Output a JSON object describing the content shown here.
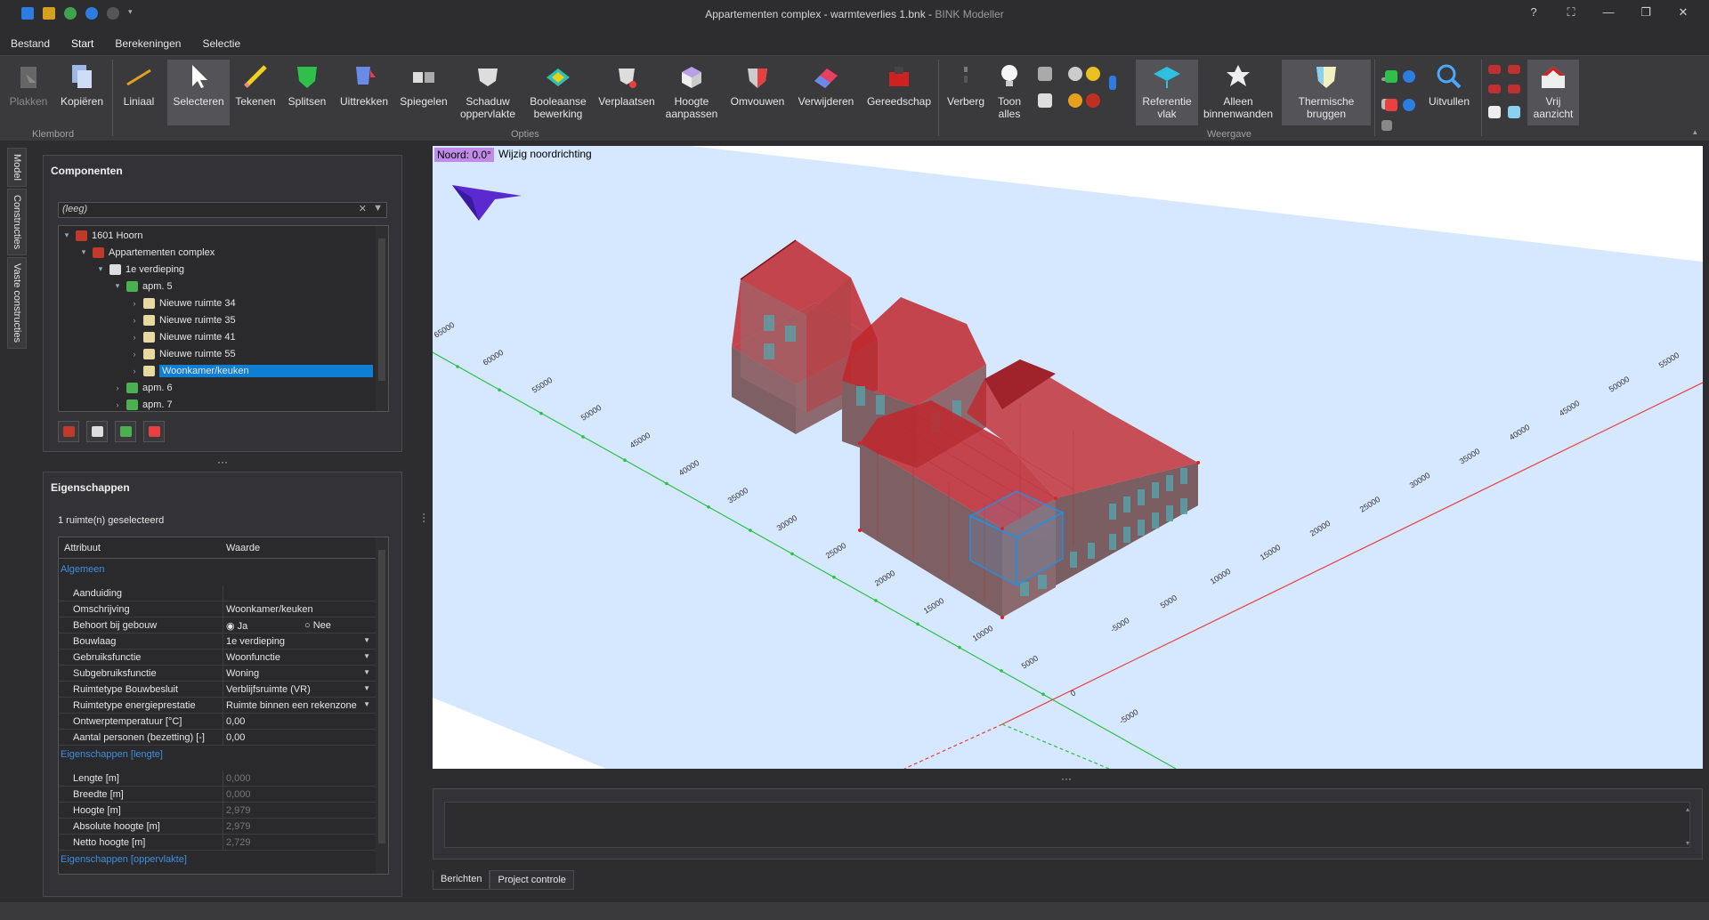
{
  "window": {
    "title": "Appartementen complex - warmteverlies 1.bnk",
    "app_name": "BINK Modeller"
  },
  "menu": {
    "tabs": [
      "Bestand",
      "Start",
      "Berekeningen",
      "Selectie"
    ]
  },
  "ribbon": {
    "plakken": "Plakken",
    "kopieren": "Kopiëren",
    "liniaal": "Liniaal",
    "selecteren": "Selecteren",
    "tekenen": "Tekenen",
    "splitsen": "Splitsen",
    "uittrekken": "Uittrekken",
    "spiegelen": "Spiegelen",
    "schaduw1": "Schaduw",
    "schaduw2": "oppervlakte",
    "boolean1": "Booleaanse",
    "boolean2": "bewerking",
    "verplaatsen": "Verplaatsen",
    "hoogte1": "Hoogte",
    "hoogte2": "aanpassen",
    "omvouwen": "Omvouwen",
    "verwijderen": "Verwijderen",
    "gereedschap": "Gereedschap",
    "verberg": "Verberg",
    "toon1": "Toon",
    "toon2": "alles",
    "ref1": "Referentie",
    "ref2": "vlak",
    "alleen1": "Alleen",
    "alleen2": "binnenwanden",
    "therm1": "Thermische",
    "therm2": "bruggen",
    "uitvullen": "Uitvullen",
    "vrij1": "Vrij",
    "vrij2": "aanzicht",
    "group_klembord": "Klembord",
    "group_opties": "Opties",
    "group_weergave": "Weergave"
  },
  "side_tabs": [
    "Model",
    "Constructies",
    "Vaste constructies"
  ],
  "components": {
    "title": "Componenten",
    "search_value": "(leeg)",
    "tree": [
      {
        "label": "1601 Hoorn",
        "level": 0,
        "arrow": "▾",
        "color": "#c0392b"
      },
      {
        "label": "Appartementen complex",
        "level": 1,
        "arrow": "▾",
        "color": "#c0392b"
      },
      {
        "label": "1e verdieping",
        "level": 2,
        "arrow": "▾",
        "color": "#dddddd"
      },
      {
        "label": "apm. 5",
        "level": 3,
        "arrow": "▾",
        "color": "#4caf50"
      },
      {
        "label": "Nieuwe ruimte 34",
        "level": 4,
        "arrow": "›",
        "color": "#e8d9a0"
      },
      {
        "label": "Nieuwe ruimte 35",
        "level": 4,
        "arrow": "›",
        "color": "#e8d9a0"
      },
      {
        "label": "Nieuwe ruimte 41",
        "level": 4,
        "arrow": "›",
        "color": "#e8d9a0"
      },
      {
        "label": "Nieuwe ruimte 55",
        "level": 4,
        "arrow": "›",
        "color": "#e8d9a0"
      },
      {
        "label": "Woonkamer/keuken",
        "level": 4,
        "arrow": "›",
        "color": "#e8d9a0",
        "selected": true
      },
      {
        "label": "apm. 6",
        "level": 3,
        "arrow": "›",
        "color": "#4caf50"
      },
      {
        "label": "apm. 7",
        "level": 3,
        "arrow": "›",
        "color": "#4caf50"
      }
    ]
  },
  "properties": {
    "title": "Eigenschappen",
    "selection_info": "1 ruimte(n) geselecteerd",
    "col_attr": "Attribuut",
    "col_value": "Waarde",
    "group_algemeen": "Algemeen",
    "group_lengte": "Eigenschappen [lengte]",
    "group_oppervlakte": "Eigenschappen [oppervlakte]",
    "radio_ja": "Ja",
    "radio_nee": "Nee",
    "rows_algemeen": [
      {
        "attr": "Aanduiding",
        "value": ""
      },
      {
        "attr": "Omschrijving",
        "value": "Woonkamer/keuken"
      },
      {
        "attr": "Behoort bij gebouw",
        "value": "",
        "radio": true
      },
      {
        "attr": "Bouwlaag",
        "value": "1e verdieping",
        "dropdown": true
      },
      {
        "attr": "Gebruiksfunctie",
        "value": "Woonfunctie",
        "dropdown": true
      },
      {
        "attr": "Subgebruiksfunctie",
        "value": "Woning",
        "dropdown": true
      },
      {
        "attr": "Ruimtetype Bouwbesluit",
        "value": "Verblijfsruimte (VR)",
        "dropdown": true
      },
      {
        "attr": "Ruimtetype energieprestatie",
        "value": "Ruimte binnen een rekenzone",
        "dropdown": true
      },
      {
        "attr": "Ontwerptemperatuur [°C]",
        "value": "0,00"
      },
      {
        "attr": "Aantal personen (bezetting) [-]",
        "value": "0,00"
      }
    ],
    "rows_lengte": [
      {
        "attr": "Lengte [m]",
        "value": "0,000"
      },
      {
        "attr": "Breedte [m]",
        "value": "0,000"
      },
      {
        "attr": "Hoogte [m]",
        "value": "2,979"
      },
      {
        "attr": "Absolute hoogte [m]",
        "value": "2,979"
      },
      {
        "attr": "Netto hoogte [m]",
        "value": "2,729"
      }
    ]
  },
  "viewport": {
    "north_label": "Noord: 0.0°",
    "north_action": "Wijzig noordrichting",
    "green_axis_ticks": [
      "65000",
      "60000",
      "55000",
      "50000",
      "45000",
      "40000",
      "35000",
      "30000",
      "25000",
      "20000",
      "15000",
      "10000",
      "5000",
      "0",
      "-5000"
    ],
    "red_axis_ticks": [
      "55000",
      "50000",
      "45000",
      "40000",
      "35000",
      "30000",
      "25000",
      "20000",
      "15000",
      "10000",
      "5000",
      "-5000"
    ]
  },
  "bottom_tabs": [
    "Berichten",
    "Project controle"
  ],
  "colors": {
    "accent": "#0e7fd3",
    "ground_plane": "#d6e8ff",
    "building_red": "#c0272d",
    "building_wall": "#7a5a5e",
    "north_badge": "#c08be8"
  }
}
